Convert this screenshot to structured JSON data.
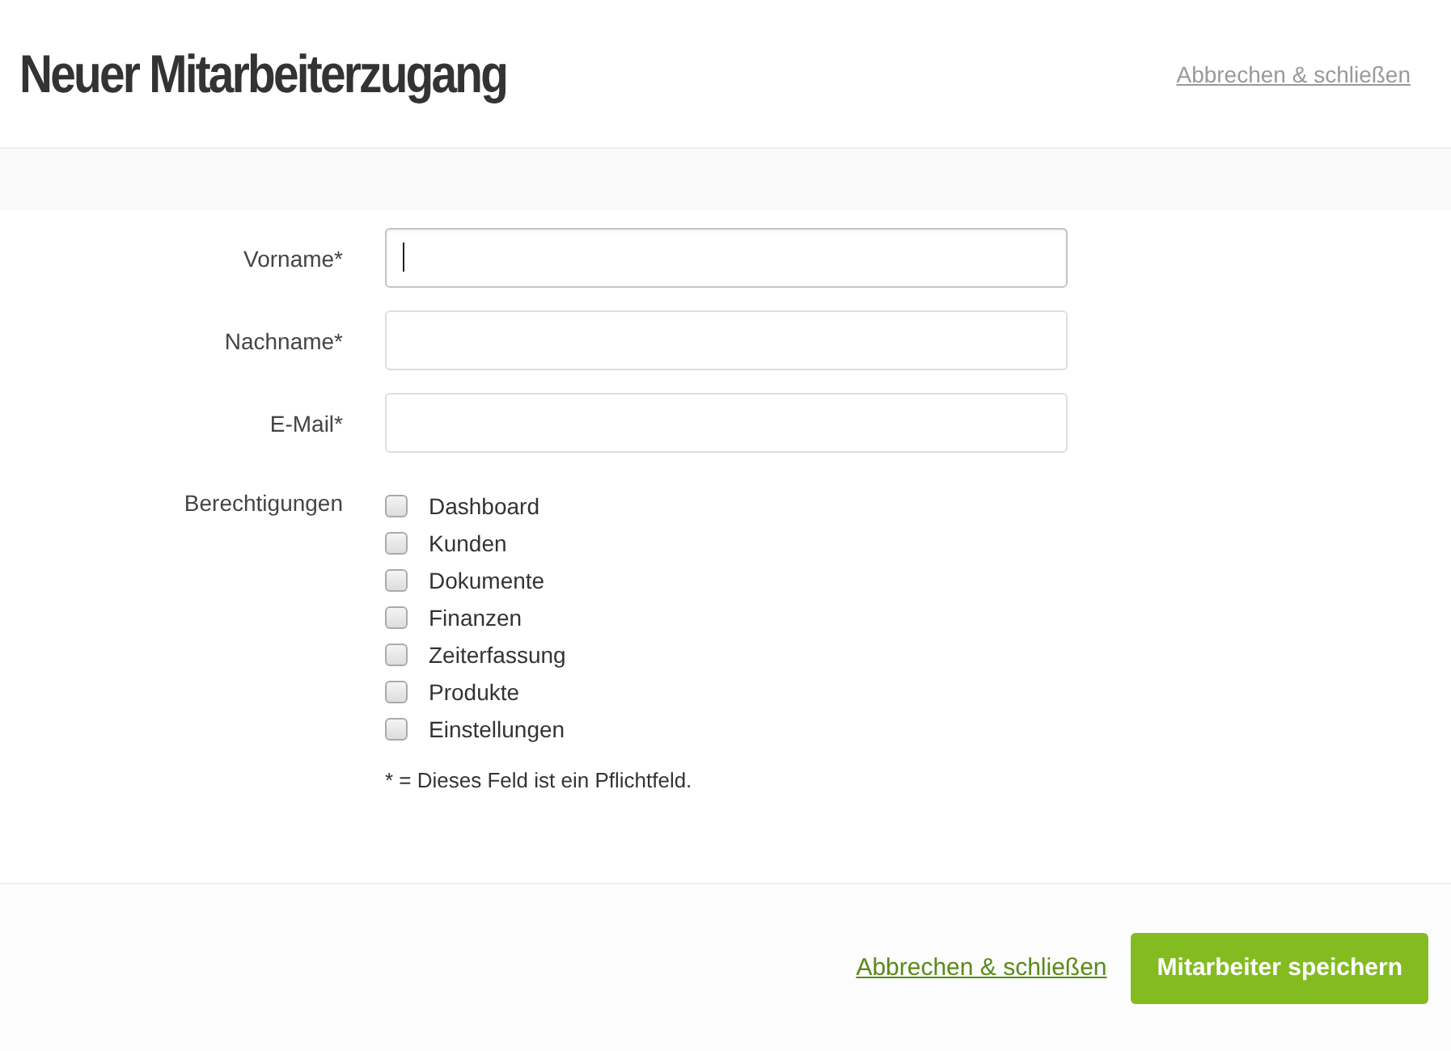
{
  "header": {
    "title": "Neuer Mitarbeiterzugang",
    "cancel_link": "Abbrechen & schließen"
  },
  "fields": [
    {
      "label": "Vorname*",
      "focused": true
    },
    {
      "label": "Nachname*",
      "focused": false
    },
    {
      "label": "E-Mail*",
      "focused": false
    }
  ],
  "permissions": {
    "label": "Berechtigungen",
    "items": [
      {
        "label": "Dashboard",
        "checked": false
      },
      {
        "label": "Kunden",
        "checked": false
      },
      {
        "label": "Dokumente",
        "checked": false
      },
      {
        "label": "Finanzen",
        "checked": false
      },
      {
        "label": "Zeiterfassung",
        "checked": false
      },
      {
        "label": "Produkte",
        "checked": false
      },
      {
        "label": "Einstellungen",
        "checked": false
      }
    ]
  },
  "required_note": "* = Dieses Feld ist ein Pflichtfeld.",
  "footer": {
    "cancel_link": "Abbrechen & schließen",
    "save_button": "Mitarbeiter speichern"
  }
}
